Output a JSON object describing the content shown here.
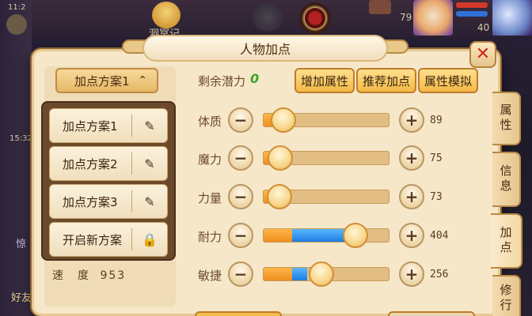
{
  "background": {
    "time_top": "11:2",
    "time_mid": "15:32",
    "partial_top_text": "洞冥记",
    "level_badge": "79",
    "level_badge2": "40",
    "left_edge_texts": [
      "惊",
      "好友"
    ]
  },
  "panel": {
    "title": "人物加点",
    "close_icon": "close-icon"
  },
  "scheme": {
    "dropdown_label": "加点方案1",
    "dropdown_arrow": "⌃",
    "items": [
      {
        "label": "加点方案1",
        "icon": "✎"
      },
      {
        "label": "加点方案2",
        "icon": "✎"
      },
      {
        "label": "加点方案3",
        "icon": "✎"
      },
      {
        "label": "开启新方案",
        "icon": "🔒"
      }
    ]
  },
  "speed": {
    "label": "速　度",
    "value": "953"
  },
  "points": {
    "label": "剩余潜力",
    "value": "0"
  },
  "buttons": {
    "add_attr": "增加属性",
    "recommend": "推荐加点",
    "simulate": "属性模拟"
  },
  "attributes": [
    {
      "name": "体质",
      "value": "89",
      "base_fraction": 0.0,
      "add_fraction": 0.0,
      "knob_fraction": 0.16
    },
    {
      "name": "魔力",
      "value": "75",
      "base_fraction": 0.0,
      "add_fraction": 0.0,
      "knob_fraction": 0.14
    },
    {
      "name": "力量",
      "value": "73",
      "base_fraction": 0.0,
      "add_fraction": 0.0,
      "knob_fraction": 0.13
    },
    {
      "name": "耐力",
      "value": "404",
      "base_fraction": 0.23,
      "add_fraction": 0.5,
      "knob_fraction": 0.73
    },
    {
      "name": "敏捷",
      "value": "256",
      "base_fraction": 0.23,
      "add_fraction": 0.12,
      "knob_fraction": 0.46
    }
  ],
  "minus_symbol": "−",
  "plus_symbol": "+",
  "side_tabs": [
    {
      "label": "属性",
      "active": false
    },
    {
      "label": "信息",
      "active": false
    },
    {
      "label": "加点",
      "active": true
    },
    {
      "label": "修行",
      "active": false
    }
  ],
  "colors": {
    "panel_bg": "#f6e7c9",
    "button_gold": "#f2b945",
    "fill_orange": "#ef8e1f",
    "fill_blue": "#1e7de0",
    "points_green": "#3aa52a",
    "close_red": "#d12a1a"
  }
}
